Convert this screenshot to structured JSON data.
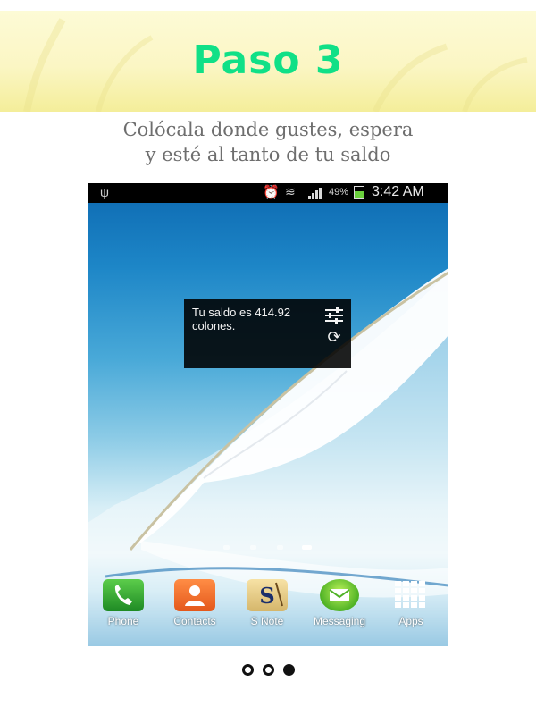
{
  "header": {
    "title": "Paso 3"
  },
  "subtitle": {
    "line1": "Colócala donde gustes, espera",
    "line2": "y esté al tanto de tu saldo"
  },
  "statusbar": {
    "usb_icon": "usb-icon",
    "alarm_icon": "alarm-icon",
    "wifi_icon": "wifi-icon",
    "signal_icon": "signal-icon",
    "battery_percent": "49%",
    "battery_icon": "battery-charging-icon",
    "time": "3:42 AM"
  },
  "widget": {
    "text": "Tu saldo es 414.92 colones.",
    "settings_icon": "sliders-icon",
    "refresh_icon": "refresh-icon"
  },
  "home_pages": {
    "count": 4,
    "active_index": 3
  },
  "dock": {
    "apps": [
      {
        "label": "Phone",
        "icon": "phone-icon"
      },
      {
        "label": "Contacts",
        "icon": "contacts-icon"
      },
      {
        "label": "S Note",
        "icon": "snote-icon"
      },
      {
        "label": "Messaging",
        "icon": "messaging-icon"
      },
      {
        "label": "Apps",
        "icon": "apps-grid-icon"
      }
    ]
  },
  "carousel": {
    "count": 3,
    "active_index": 2
  },
  "colors": {
    "title": "#10e087",
    "subtitle": "#6e6e6e",
    "header_bg": "#fbf6c4"
  }
}
